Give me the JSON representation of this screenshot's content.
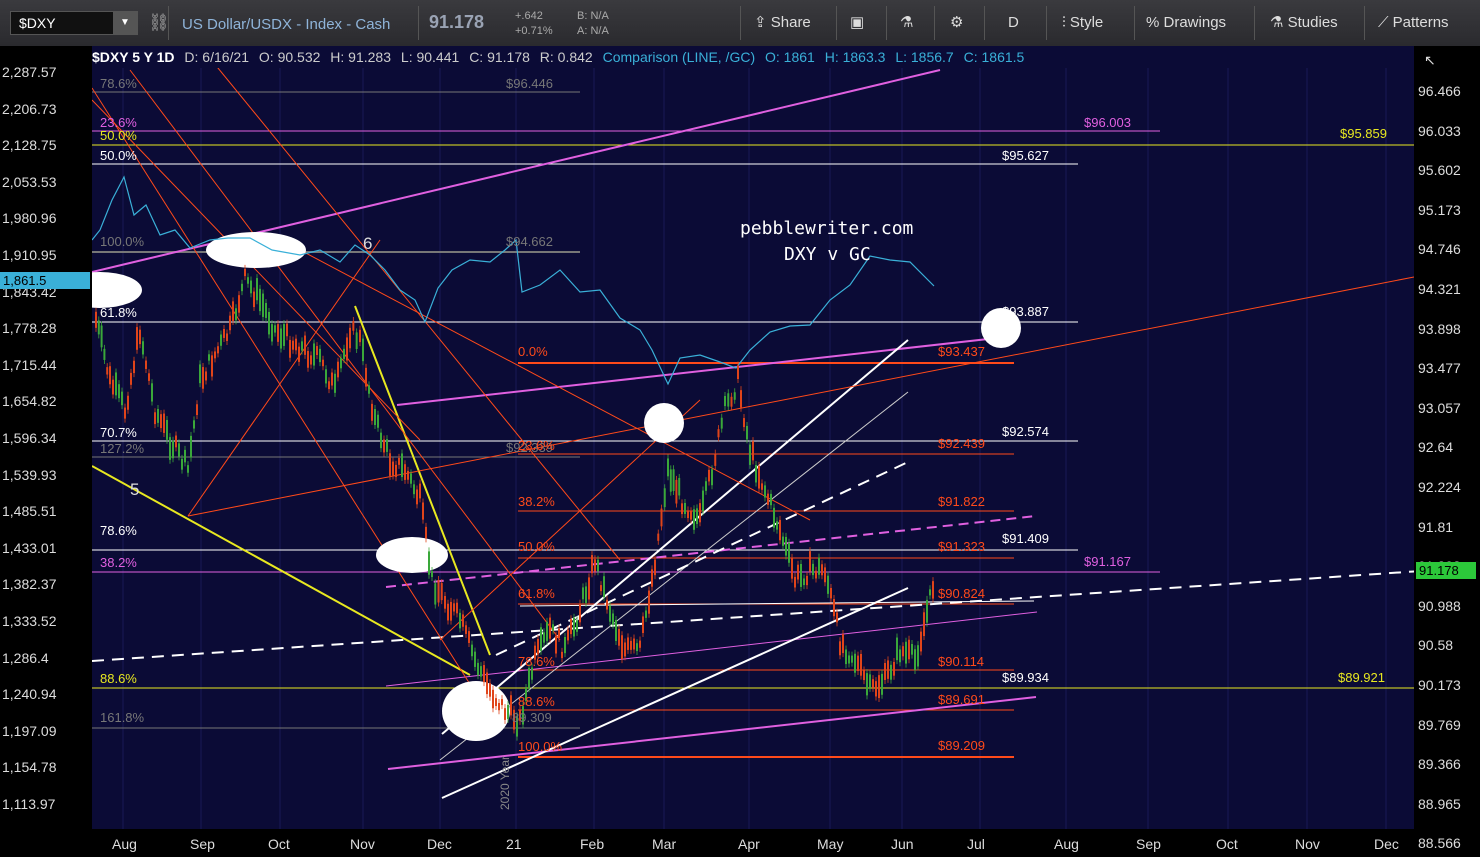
{
  "toolbar": {
    "symbol": "$DXY",
    "name": "US Dollar/USDX - Index - Cash",
    "price": "91.178",
    "change": "+.642",
    "change_pct": "+0.71%",
    "bid": "B: N/A",
    "ask": "A: N/A",
    "share": "Share",
    "interval": "D",
    "style": "Style",
    "drawings": "Drawings",
    "studies": "Studies",
    "patterns": "Patterns"
  },
  "header": {
    "sym": "$DXY 5 Y 1D",
    "date": "D: 6/16/21",
    "open": "O: 90.532",
    "high": "H: 91.283",
    "low": "L: 90.441",
    "close": "C: 91.178",
    "range": "R: 0.842",
    "comparison": "Comparison (LINE, /GC)",
    "cmp_open": "O: 1861",
    "cmp_high": "H: 1863.3",
    "cmp_low": "L: 1856.7",
    "cmp_close": "C: 1861.5"
  },
  "left_axis": [
    "2,287.57",
    "2,206.73",
    "2,128.75",
    "2,053.53",
    "1,980.96",
    "1,910.95",
    "1,843.42",
    "1,778.28",
    "1,715.44",
    "1,654.82",
    "1,596.34",
    "1,539.93",
    "1,485.51",
    "1,433.01",
    "1,382.37",
    "1,333.52",
    "1,286.4",
    "1,240.94",
    "1,197.09",
    "1,154.78",
    "1,113.97"
  ],
  "right_axis": [
    "96.466",
    "96.033",
    "95.602",
    "95.173",
    "94.746",
    "94.321",
    "93.898",
    "93.477",
    "93.057",
    "92.64",
    "92.224",
    "91.81",
    "91.398",
    "90.988",
    "90.58",
    "90.173",
    "89.769",
    "89.366",
    "88.965",
    "88.566"
  ],
  "x_axis": [
    "Aug",
    "Sep",
    "Oct",
    "Nov",
    "Dec",
    "21",
    "Feb",
    "Mar",
    "Apr",
    "May",
    "Jun",
    "Jul",
    "Aug",
    "Sep",
    "Oct",
    "Nov",
    "Dec"
  ],
  "badges": {
    "gc": "1,861.5",
    "dxy": "91.178"
  },
  "annotations": {
    "site": "pebblewriter.com",
    "title": "DXY v GC",
    "wave5": "5",
    "wave6": "6",
    "year": "2020 Year"
  },
  "fib_left": {
    "f786a": "78.6%",
    "f236": "23.6%",
    "f500y": "50.0%",
    "f500w": "50.0%",
    "f1000": "100.0%",
    "f618": "61.8%",
    "f707": "70.7%",
    "f1272": "127.2%",
    "f786b": "78.6%",
    "f382": "38.2%",
    "f886": "88.6%",
    "f1618": "161.8%"
  },
  "fib_mid": {
    "p96446": "$96.446",
    "p94662": "$94.662",
    "p0": "0.0%",
    "p236": "23.6%",
    "p382": "38.2%",
    "p50": "50.0%",
    "p618": "61.8%",
    "p786": "78.6%",
    "p886": "88.6%",
    "p100": "100.0%",
    "p89309": "89.309",
    "p92339": "$92.339"
  },
  "fib_right": {
    "r96003": "$96.003",
    "r95859": "$95.859",
    "r95627": "$95.627",
    "r93887": "$93.887",
    "r93437": "$93.437",
    "r92574": "$92.574",
    "r92439": "$92.439",
    "r91822": "$91.822",
    "r91409": "$91.409",
    "r91323": "$91.323",
    "r91167": "$91.167",
    "r90824": "$90.824",
    "r90114": "$90.114",
    "r89934": "$89.934",
    "r89921": "$89.921",
    "r89691": "$89.691",
    "r89209": "$89.209"
  },
  "colors": {
    "bg": "#0b0b36",
    "up": "#3aa83a",
    "down": "#e0441a",
    "gc": "#3ab0d8",
    "fib_pink": "#e060e0",
    "fib_yellow": "#e8e820",
    "fib_red": "#ff4a1a"
  }
}
